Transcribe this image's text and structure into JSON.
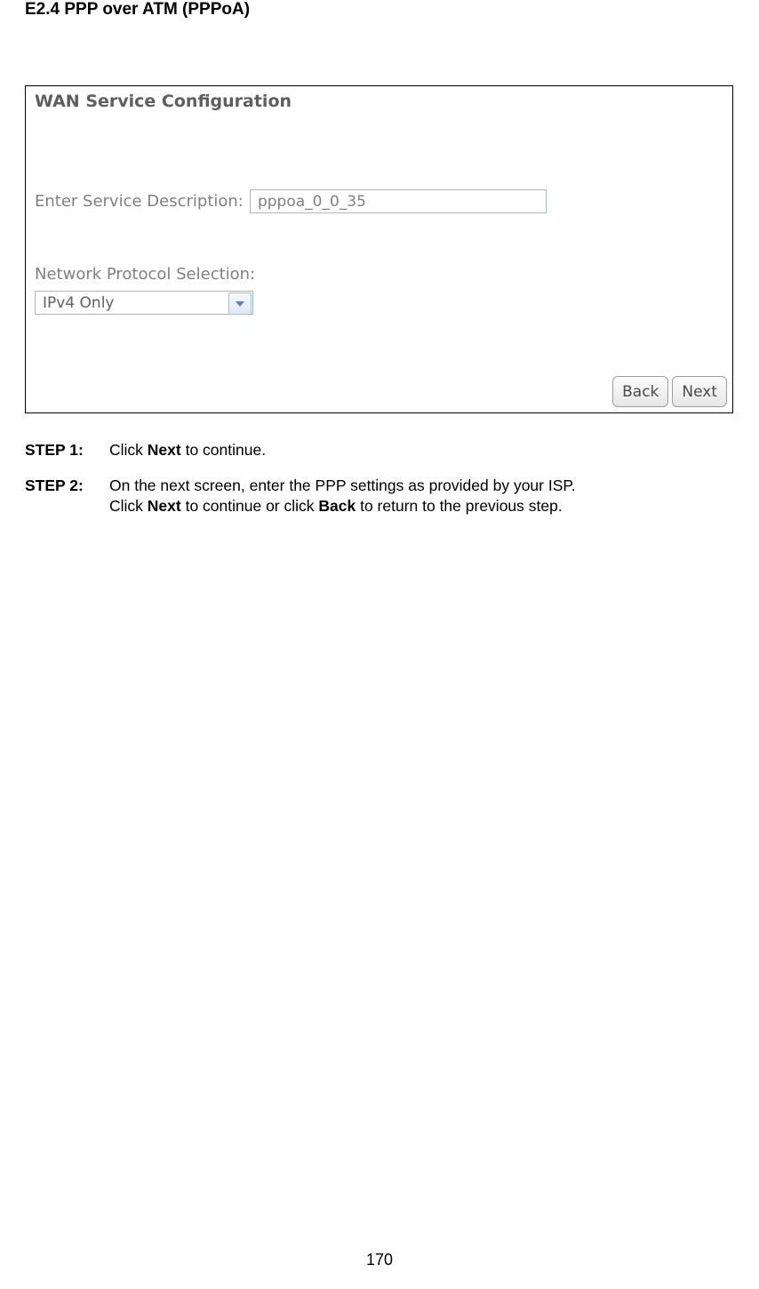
{
  "heading": "E2.4 PPP over ATM (PPPoA)",
  "panel": {
    "title": "WAN Service Configuration",
    "service_label": "Enter Service Description:",
    "service_value": "pppoa_0_0_35",
    "protocol_label": "Network Protocol Selection:",
    "protocol_value": "IPv4 Only",
    "back": "Back",
    "next": "Next"
  },
  "steps": {
    "step1_label": "STEP 1:",
    "step1_pre": "Click ",
    "step1_b": "Next",
    "step1_post": " to continue.",
    "step2_label": "STEP 2:",
    "step2_line1": "On the next screen, enter the PPP settings as provided by your ISP.",
    "step2_pre": "Click ",
    "step2_b1": "Next",
    "step2_mid": " to continue or click ",
    "step2_b2": "Back",
    "step2_post": " to return to the previous step."
  },
  "page_number": "170"
}
